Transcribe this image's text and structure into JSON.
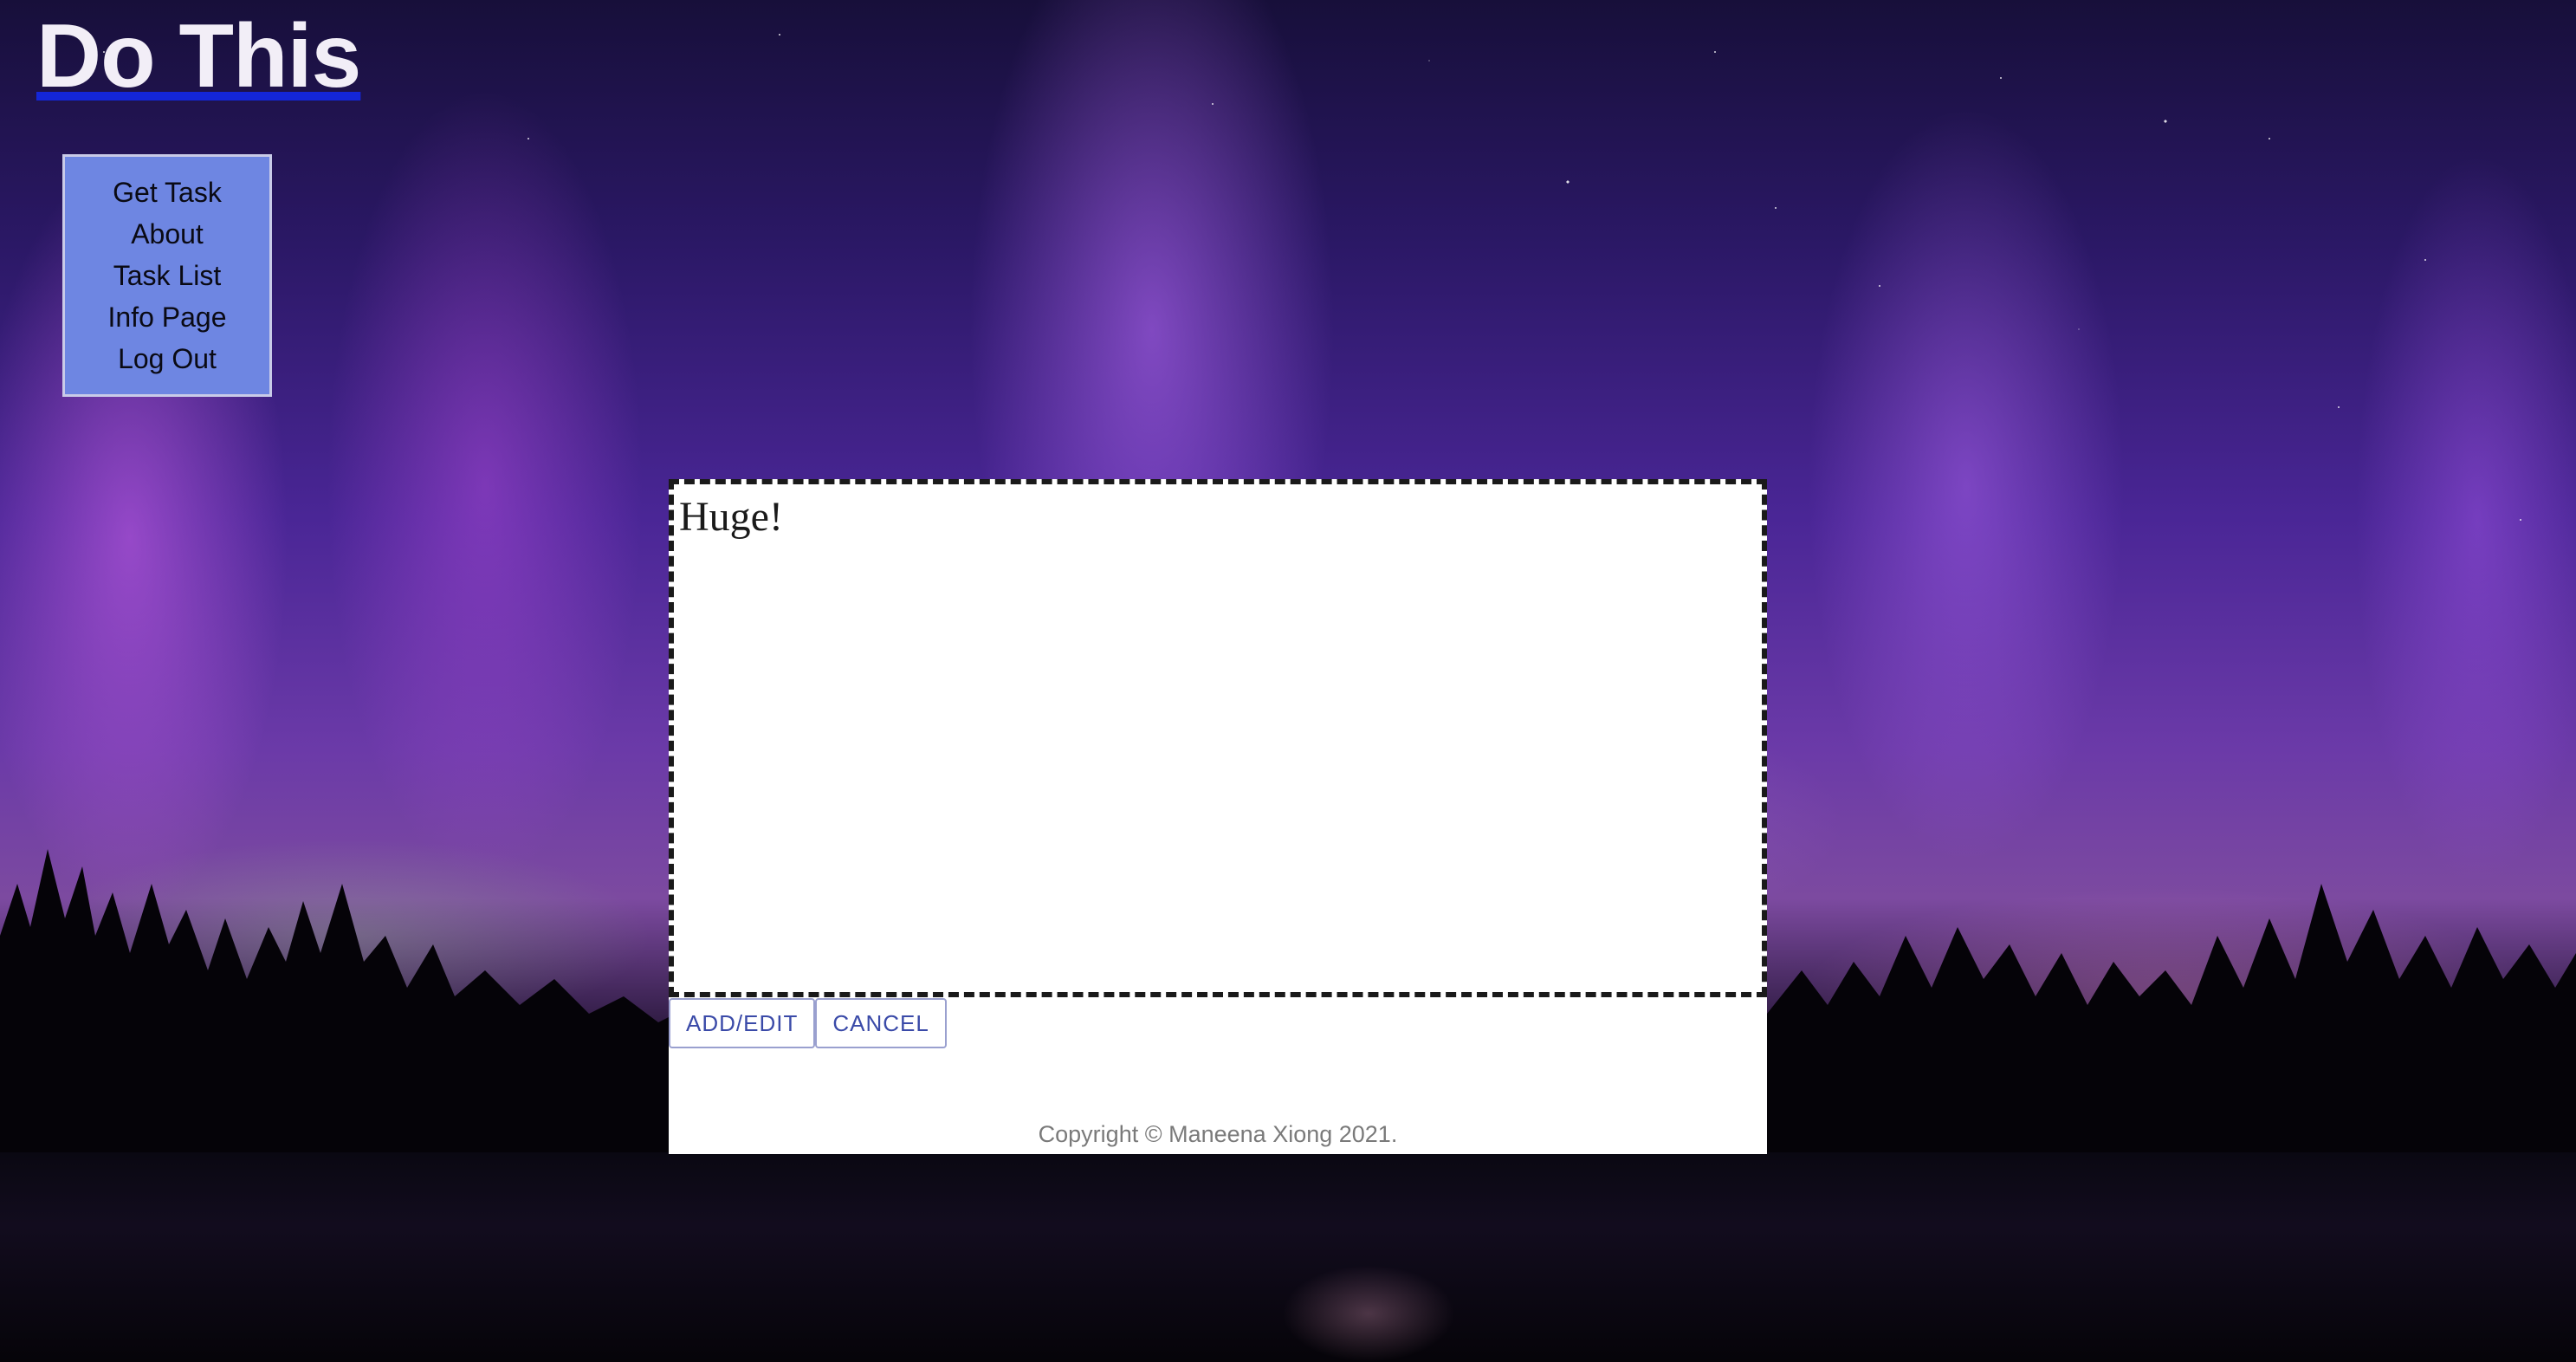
{
  "site": {
    "title": "Do This"
  },
  "nav": {
    "items": [
      {
        "label": "Get Task"
      },
      {
        "label": "About"
      },
      {
        "label": "Task List"
      },
      {
        "label": "Info Page"
      },
      {
        "label": "Log Out"
      }
    ]
  },
  "editor": {
    "value": "Huge!"
  },
  "actions": {
    "add_edit_label": "ADD/EDIT",
    "cancel_label": "CANCEL"
  },
  "footer": {
    "copyright": "Copyright © Maneena Xiong 2021."
  },
  "colors": {
    "nav_background": "#6e86e2",
    "title_underline": "#1426d8",
    "button_text": "#3a4aa8"
  }
}
